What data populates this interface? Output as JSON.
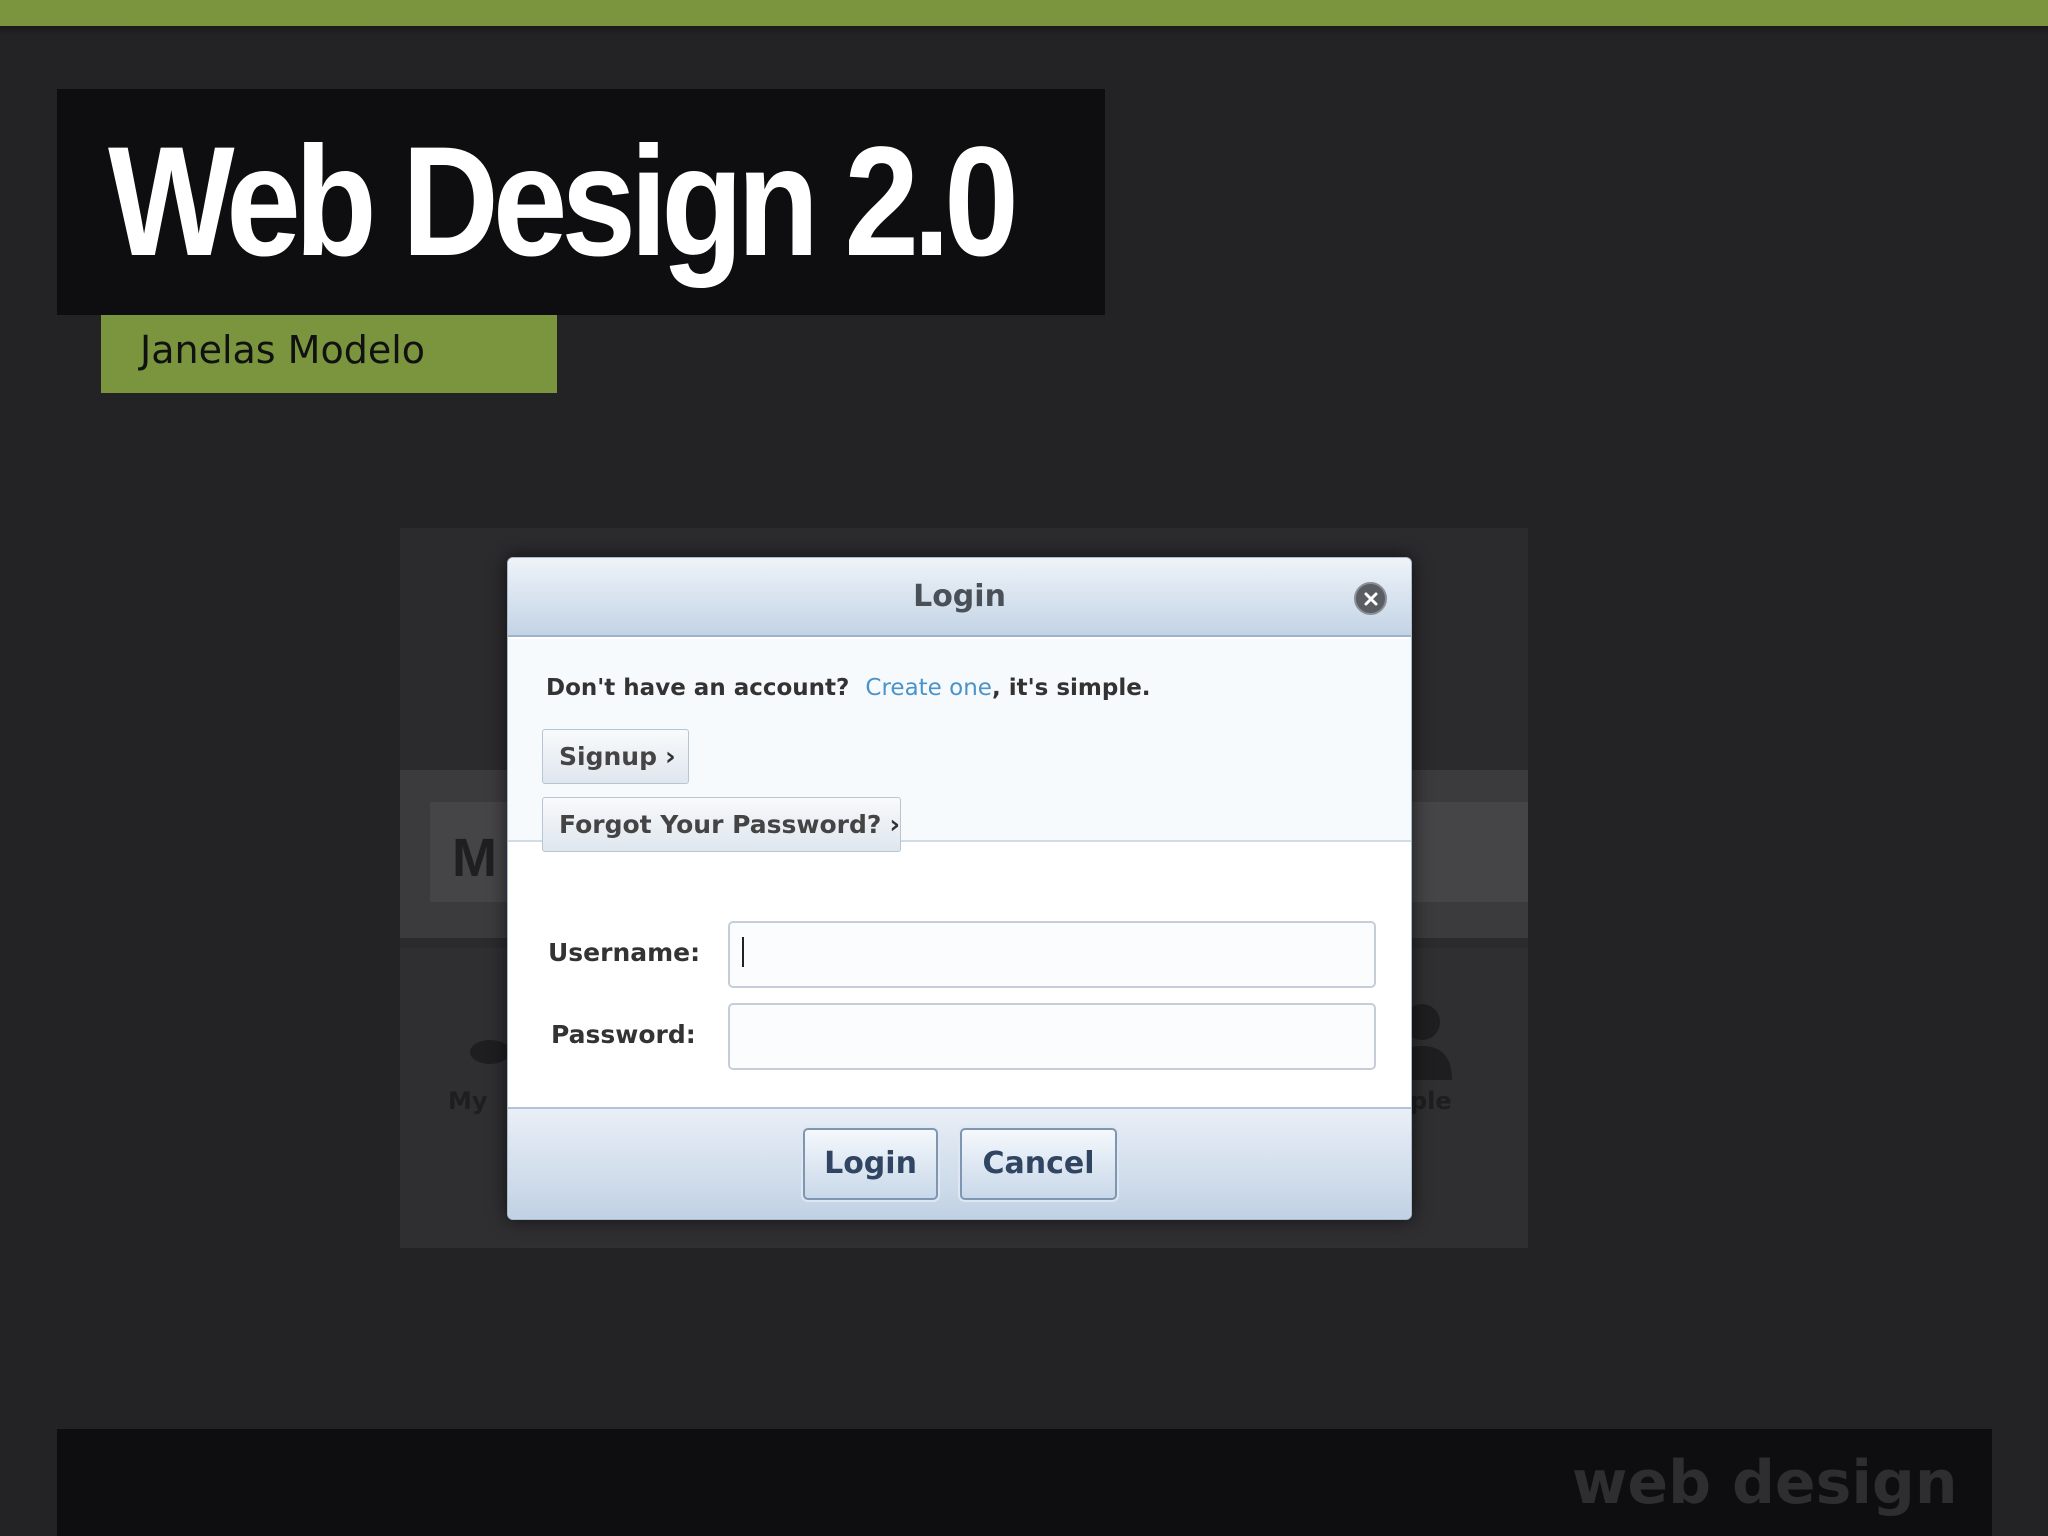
{
  "slide": {
    "title": "Web Design 2.0",
    "subtitle": "Janelas Modelo",
    "footer_brand": "web design",
    "colors": {
      "accent": "#7a953d",
      "background": "#232224",
      "dark_panel": "#0e0d10"
    }
  },
  "background_app": {
    "partial_heading": "M",
    "left_label": "My",
    "right_label": "ple"
  },
  "dialog": {
    "title": "Login",
    "close_icon": "close-icon",
    "prompt_text": "Don't have an account?",
    "create_link": "Create one",
    "prompt_suffix": ", it's simple.",
    "signup_label": "Signup",
    "forgot_label": "Forgot Your Password?",
    "chevron": "›",
    "username_label": "Username:",
    "username_value": "",
    "password_label": "Password:",
    "password_value": "",
    "login_button": "Login",
    "cancel_button": "Cancel",
    "colors": {
      "link": "#4b93c9",
      "header_gradient_top": "#eef3f8",
      "header_gradient_bottom": "#c3d4e6"
    }
  }
}
